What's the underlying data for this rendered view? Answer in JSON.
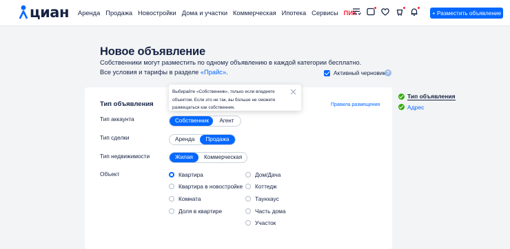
{
  "header": {
    "logo_text": "циан",
    "nav": [
      "Аренда",
      "Продажа",
      "Новостройки",
      "Дома и участки",
      "Коммерческая",
      "Ипотека",
      "Сервисы"
    ],
    "nav_pik": "ПИК",
    "icons": [
      "compare-icon",
      "chat-icon",
      "heart-icon",
      "notifications-icon",
      "bell-icon"
    ],
    "post_button": "+ Разместить объявление"
  },
  "page": {
    "title": "Новое объявление",
    "subtitle_line1": "Собственники могут разместить по одному объявлению в каждой категории бесплатно.",
    "subtitle_prefix": "Все условия и тарифы в разделе ",
    "subtitle_link": "«Прайс»",
    "subtitle_suffix": ".",
    "active_draft": "Активный черновик",
    "help": "?"
  },
  "form": {
    "section_title": "Тип объявления",
    "rules_link": "Правила размещения",
    "account": {
      "label": "Тип аккаунта",
      "options": [
        "Собственник",
        "Агент"
      ],
      "selected": "Собственник"
    },
    "deal": {
      "label": "Тип сделки",
      "options": [
        "Аренда",
        "Продажа"
      ],
      "selected": "Продажа"
    },
    "property": {
      "label": "Тип недвижимости",
      "options": [
        "Жилая",
        "Коммерческая"
      ],
      "selected": "Жилая"
    },
    "object": {
      "label": "Объект",
      "col1": [
        "Квартира",
        "Квартира в новостройке",
        "Комната",
        "Доля в квартире"
      ],
      "col2": [
        "Дом/Дача",
        "Коттедж",
        "Таунхаус",
        "Часть дома",
        "Участок"
      ],
      "selected": "Квартира"
    }
  },
  "tooltip": {
    "lines": [
      "Выбирайте «Собственник», только если владеете",
      "объектом. Если это не так, вы больше не сможете",
      "размещаться как собственник."
    ]
  },
  "steps": [
    {
      "label": "Тип объявления",
      "active": true
    },
    {
      "label": "Адрес",
      "active": false
    }
  ],
  "colors": {
    "accent": "#0468ff",
    "brand_text": "#152242",
    "pik": "#ff1f34",
    "success": "#34ac0a"
  }
}
